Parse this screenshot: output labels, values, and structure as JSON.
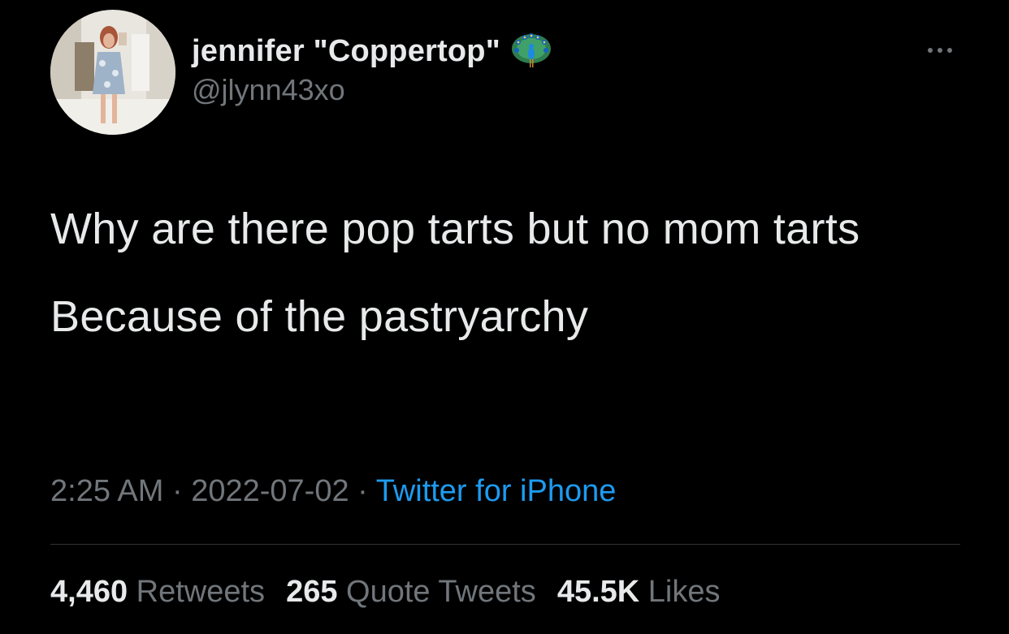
{
  "tweet": {
    "author": {
      "display_name": "jennifer \"Coppertop\"",
      "name_emoji": "peacock-icon",
      "handle": "@jlynn43xo",
      "avatar": "avatar-photo"
    },
    "body": [
      "Why are there pop tarts but no mom tarts",
      "Because of the pastryarchy"
    ],
    "meta": {
      "time": "2:25 AM",
      "separator": "·",
      "date": "2022-07-02",
      "source": "Twitter for iPhone"
    },
    "stats": {
      "retweets_count": "4,460",
      "retweets_label": "Retweets",
      "quotes_count": "265",
      "quotes_label": "Quote Tweets",
      "likes_count": "45.5K",
      "likes_label": "Likes"
    },
    "colors": {
      "background": "#000000",
      "primary_text": "#e7e9ea",
      "secondary_text": "#71767b",
      "link": "#1d9bf0",
      "divider": "#2f3336"
    }
  }
}
